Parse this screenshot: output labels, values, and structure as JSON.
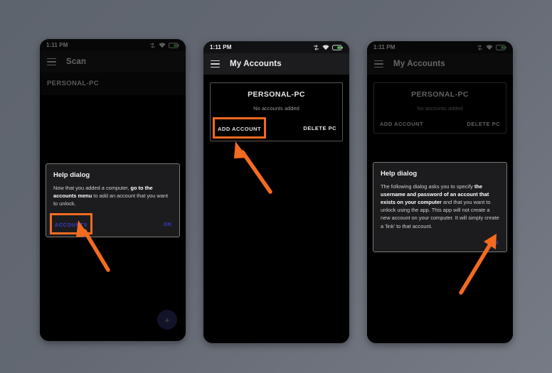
{
  "background": {
    "color_top_left": "#5e646e",
    "color_bottom_right": "#767b85"
  },
  "accent": {
    "highlight": "#f36b21",
    "dialog_button": "#3b3bd6",
    "fab": "#2d2f63",
    "battery": "#3ec13e"
  },
  "status_bar": {
    "time": "1:11 PM",
    "icons": [
      "data-transfer-icon",
      "wifi-icon",
      "battery-icon"
    ]
  },
  "phones": [
    {
      "id": "phone-1",
      "appbar": {
        "menu_icon": "hamburger-icon",
        "title": "Scan"
      },
      "list": [
        {
          "label": "PERSONAL-PC"
        }
      ],
      "fab": {
        "icon": "plus-icon",
        "label": "+"
      },
      "dialog": {
        "title": "Help dialog",
        "body_prefix": "Now that you added a computer, ",
        "body_bold": "go to the accounts menu",
        "body_suffix": " to add an account that you want to unlock.",
        "buttons": [
          {
            "label": "ACCOUNTS",
            "highlighted": true
          },
          {
            "label": "OK",
            "highlighted": false
          }
        ]
      },
      "annotation": {
        "arrow": "arrow-pointing-up-left",
        "target": "ACCOUNTS"
      }
    },
    {
      "id": "phone-2",
      "appbar": {
        "menu_icon": "hamburger-icon",
        "title": "My Accounts"
      },
      "card": {
        "title": "PERSONAL-PC",
        "subtitle": "No accounts added",
        "actions": [
          {
            "label": "ADD ACCOUNT",
            "highlighted": true
          },
          {
            "label": "DELETE PC",
            "highlighted": false
          }
        ]
      },
      "annotation": {
        "arrow": "arrow-pointing-up-left",
        "target": "ADD ACCOUNT"
      }
    },
    {
      "id": "phone-3",
      "appbar": {
        "menu_icon": "hamburger-icon",
        "title": "My Accounts"
      },
      "card": {
        "title": "PERSONAL-PC",
        "subtitle": "No accounts added",
        "actions": [
          {
            "label": "ADD ACCOUNT",
            "highlighted": false
          },
          {
            "label": "DELETE PC",
            "highlighted": false
          }
        ]
      },
      "dialog": {
        "title": "Help dialog",
        "body_part1": "The following dialog asks you to specify ",
        "body_bold": "the username and password of an account that exists on your computer",
        "body_part2": " and that you want to unlock using the app. This app will not create a new account on your computer. It will simply create a 'link' to that account.",
        "buttons": [
          {
            "label": "OK",
            "highlighted": false
          }
        ]
      },
      "annotation": {
        "arrow": "arrow-pointing-up-left",
        "target": "OK"
      }
    }
  ]
}
